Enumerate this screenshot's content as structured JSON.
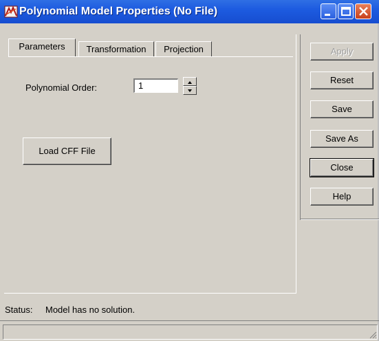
{
  "window": {
    "title": "Polynomial Model Properties (No File)"
  },
  "tabs": [
    {
      "label": "Parameters",
      "active": true
    },
    {
      "label": "Transformation",
      "active": false
    },
    {
      "label": "Projection",
      "active": false
    }
  ],
  "parameters": {
    "polynomial_order_label": "Polynomial Order:",
    "polynomial_order_value": "1",
    "load_cff_label": "Load CFF File"
  },
  "buttons": {
    "apply": "Apply",
    "reset": "Reset",
    "save": "Save",
    "save_as": "Save As",
    "close": "Close",
    "help": "Help"
  },
  "status": {
    "label": "Status:",
    "text": "Model has no solution."
  },
  "colors": {
    "titlebar": "#1d5be0",
    "face": "#d4d0c8",
    "close_button": "#c8401c"
  }
}
